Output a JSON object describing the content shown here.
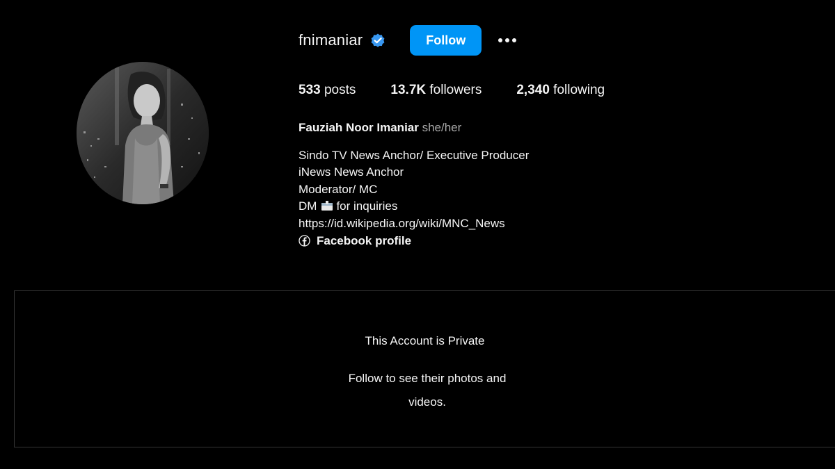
{
  "profile": {
    "username": "fnimaniar",
    "follow_label": "Follow",
    "stats": {
      "posts_count": "533",
      "posts_label": " posts",
      "followers_count": "13.7K",
      "followers_label": " followers",
      "following_count": "2,340",
      "following_label": " following"
    },
    "full_name": "Fauziah Noor Imaniar",
    "pronouns": " she/her",
    "bio_lines": [
      "Sindo TV News Anchor/ Executive Producer",
      "iNews News Anchor",
      "Moderator/ MC"
    ],
    "dm_prefix": "DM",
    "dm_suffix": "for inquiries",
    "website": "https://id.wikipedia.org/wiki/MNC_News",
    "facebook_label": "Facebook profile"
  },
  "private": {
    "title": "This Account is Private",
    "subtitle": "Follow to see their photos and videos."
  },
  "colors": {
    "background": "#000000",
    "accent": "#0095f6",
    "verified": "#3897f0",
    "divider": "#363636"
  },
  "icons": [
    "verified-badge-icon",
    "more-options-icon",
    "envelope-icon",
    "facebook-icon"
  ]
}
